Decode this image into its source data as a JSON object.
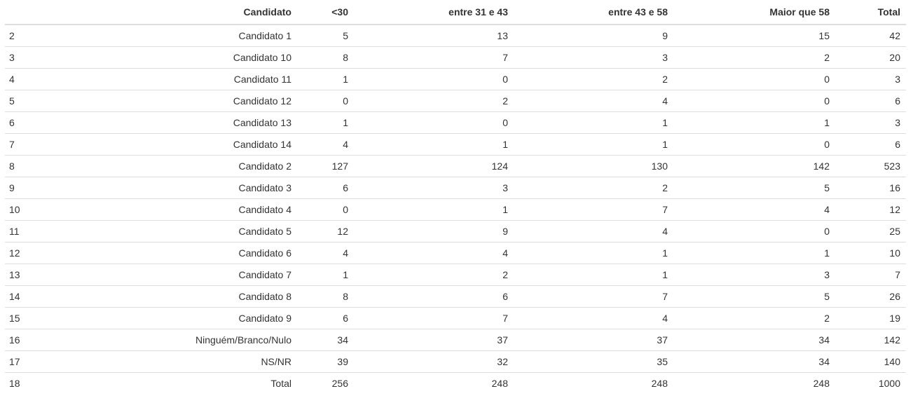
{
  "table": {
    "columns": [
      "",
      "Candidato",
      "<30",
      "entre 31 e 43",
      "entre 43 e 58",
      "Maior que 58",
      "Total"
    ],
    "rows": [
      [
        "2",
        "Candidato 1",
        "5",
        "13",
        "9",
        "15",
        "42"
      ],
      [
        "3",
        "Candidato 10",
        "8",
        "7",
        "3",
        "2",
        "20"
      ],
      [
        "4",
        "Candidato 11",
        "1",
        "0",
        "2",
        "0",
        "3"
      ],
      [
        "5",
        "Candidato 12",
        "0",
        "2",
        "4",
        "0",
        "6"
      ],
      [
        "6",
        "Candidato 13",
        "1",
        "0",
        "1",
        "1",
        "3"
      ],
      [
        "7",
        "Candidato 14",
        "4",
        "1",
        "1",
        "0",
        "6"
      ],
      [
        "8",
        "Candidato 2",
        "127",
        "124",
        "130",
        "142",
        "523"
      ],
      [
        "9",
        "Candidato 3",
        "6",
        "3",
        "2",
        "5",
        "16"
      ],
      [
        "10",
        "Candidato 4",
        "0",
        "1",
        "7",
        "4",
        "12"
      ],
      [
        "11",
        "Candidato 5",
        "12",
        "9",
        "4",
        "0",
        "25"
      ],
      [
        "12",
        "Candidato 6",
        "4",
        "4",
        "1",
        "1",
        "10"
      ],
      [
        "13",
        "Candidato 7",
        "1",
        "2",
        "1",
        "3",
        "7"
      ],
      [
        "14",
        "Candidato 8",
        "8",
        "6",
        "7",
        "5",
        "26"
      ],
      [
        "15",
        "Candidato 9",
        "6",
        "7",
        "4",
        "2",
        "19"
      ],
      [
        "16",
        "Ninguém/Branco/Nulo",
        "34",
        "37",
        "37",
        "34",
        "142"
      ],
      [
        "17",
        "NS/NR",
        "39",
        "32",
        "35",
        "34",
        "140"
      ],
      [
        "18",
        "Total",
        "256",
        "248",
        "248",
        "248",
        "1000"
      ]
    ]
  },
  "colors": {
    "text": "#333333",
    "border": "#dddddd",
    "background": "#ffffff"
  }
}
